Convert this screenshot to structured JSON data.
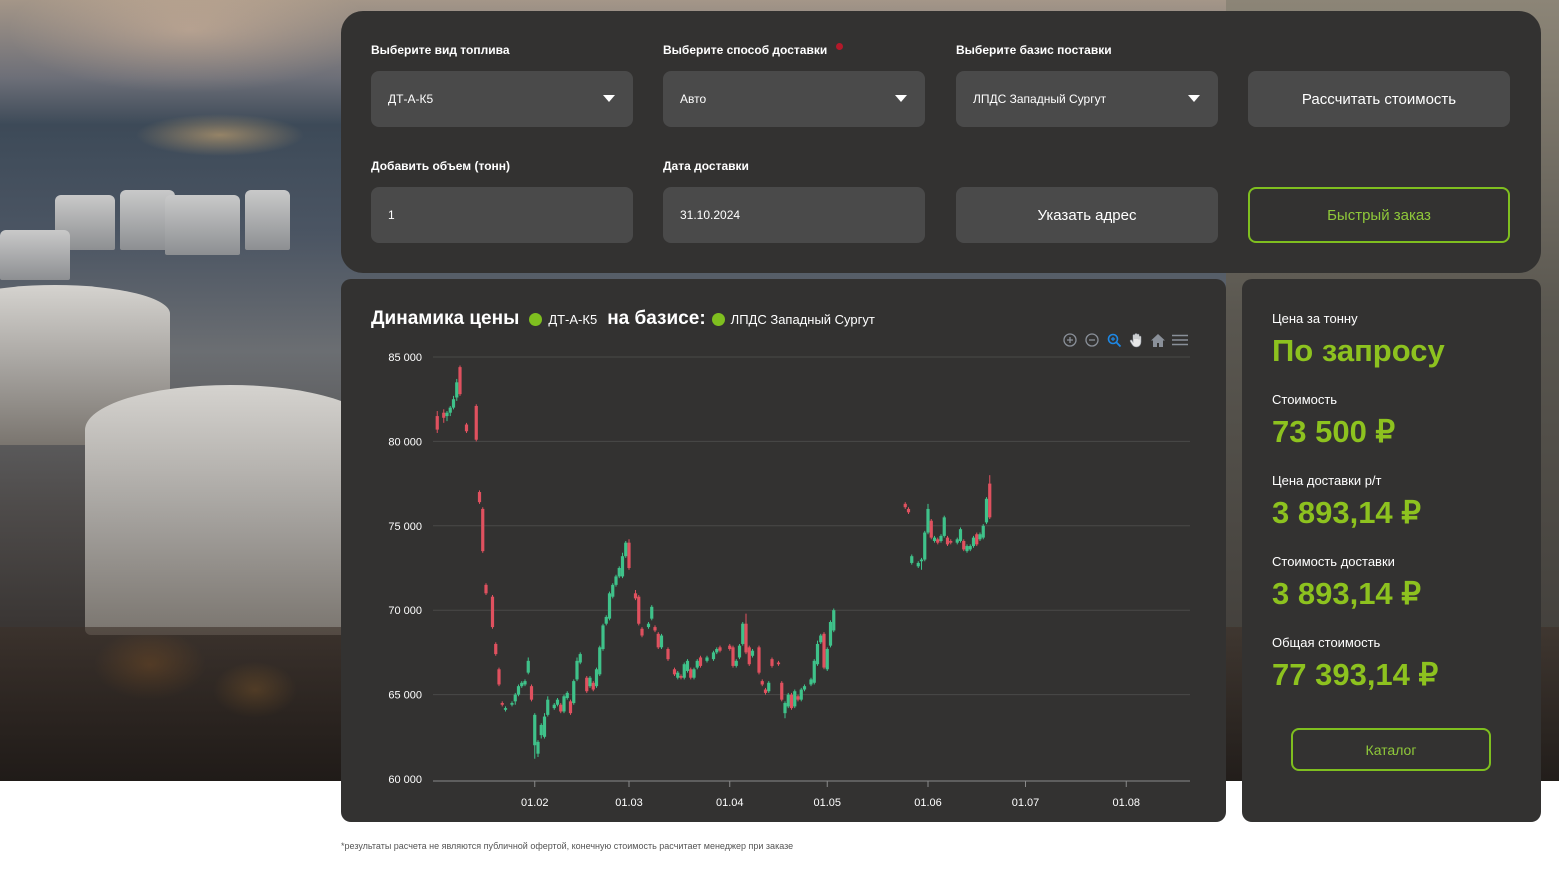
{
  "form": {
    "fuel_label": "Выберите вид топлива",
    "fuel_value": "ДТ-А-К5",
    "delivery_label": "Выберите способ доставки",
    "delivery_value": "Авто",
    "basis_label": "Выберите базис поставки",
    "basis_value": "ЛПДС Западный Сургут",
    "calc_button": "Рассчитать стоимость",
    "volume_label": "Добавить объем (тонн)",
    "volume_value": "1",
    "date_label": "Дата доставки",
    "date_value": "31.10.2024",
    "address_button": "Указать адрес",
    "quick_order_button": "Быстрый заказ"
  },
  "chart_header": {
    "title": "Динамика цены",
    "fuel": "ДТ-А-К5",
    "basis_prefix": "на базисе:",
    "basis": "ЛПДС Западный Сургут"
  },
  "colors": {
    "accent": "#8dc21f",
    "up": "#3fc28a",
    "down": "#e0515f",
    "panel": "#333231",
    "required": "#b3192a"
  },
  "toolbar_icons": [
    "zoom-in-icon",
    "zoom-out-icon",
    "zoom-select-icon",
    "pan-hand-icon",
    "home-reset-icon",
    "menu-icon"
  ],
  "chart_data": {
    "type": "candlestick",
    "title": "",
    "ylim": [
      60000,
      85000
    ],
    "yticks": [
      60000,
      65000,
      70000,
      75000,
      80000,
      85000
    ],
    "ytick_labels": [
      "60 000",
      "65 000",
      "70 000",
      "75 000",
      "80 000",
      "85 000"
    ],
    "xtick_labels": [
      "01.02",
      "01.03",
      "01.04",
      "01.05",
      "01.06",
      "01.07",
      "01.08"
    ],
    "xtick_days": [
      31,
      60,
      91,
      121,
      152,
      182,
      213
    ],
    "grid": true,
    "legend": "none",
    "series": [
      {
        "d": 1,
        "o": 81500,
        "c": 80700,
        "h": 81800,
        "l": 80500
      },
      {
        "d": 3,
        "o": 81700,
        "c": 81400,
        "h": 81900,
        "l": 81100
      },
      {
        "d": 4,
        "o": 81500,
        "c": 81700,
        "h": 81800,
        "l": 81200
      },
      {
        "d": 5,
        "o": 81700,
        "c": 82000,
        "h": 82100,
        "l": 81500
      },
      {
        "d": 6,
        "o": 82000,
        "c": 82500,
        "h": 82700,
        "l": 81900
      },
      {
        "d": 7,
        "o": 82600,
        "c": 83500,
        "h": 83700,
        "l": 82400
      },
      {
        "d": 8,
        "o": 84400,
        "c": 82800,
        "h": 84500,
        "l": 82700
      },
      {
        "d": 10,
        "o": 81000,
        "c": 80600,
        "h": 81100,
        "l": 80500
      },
      {
        "d": 13,
        "o": 82100,
        "c": 80100,
        "h": 82200,
        "l": 80000
      },
      {
        "d": 14,
        "o": 77000,
        "c": 76400,
        "h": 77100,
        "l": 76300
      },
      {
        "d": 15,
        "o": 76000,
        "c": 73500,
        "h": 76100,
        "l": 73400
      },
      {
        "d": 16,
        "o": 71500,
        "c": 71000,
        "h": 71600,
        "l": 70900
      },
      {
        "d": 18,
        "o": 70800,
        "c": 69000,
        "h": 70900,
        "l": 68900
      },
      {
        "d": 19,
        "o": 68000,
        "c": 67400,
        "h": 68100,
        "l": 67300
      },
      {
        "d": 20,
        "o": 66500,
        "c": 65600,
        "h": 66600,
        "l": 65500
      },
      {
        "d": 21,
        "o": 64500,
        "c": 64400,
        "h": 64600,
        "l": 64300
      },
      {
        "d": 22,
        "o": 64100,
        "c": 64200,
        "h": 64300,
        "l": 64000
      },
      {
        "d": 24,
        "o": 64400,
        "c": 64500,
        "h": 64600,
        "l": 64300
      },
      {
        "d": 25,
        "o": 64600,
        "c": 65000,
        "h": 65100,
        "l": 64400
      },
      {
        "d": 26,
        "o": 65000,
        "c": 65500,
        "h": 65600,
        "l": 64900
      },
      {
        "d": 27,
        "o": 65500,
        "c": 65700,
        "h": 65800,
        "l": 65400
      },
      {
        "d": 28,
        "o": 65600,
        "c": 65800,
        "h": 65900,
        "l": 65500
      },
      {
        "d": 29,
        "o": 66300,
        "c": 67000,
        "h": 67200,
        "l": 66200
      },
      {
        "d": 30,
        "o": 65500,
        "c": 64700,
        "h": 65600,
        "l": 64600
      },
      {
        "d": 31,
        "o": 62000,
        "c": 63800,
        "h": 63900,
        "l": 61200
      },
      {
        "d": 32,
        "o": 61500,
        "c": 62200,
        "h": 62300,
        "l": 61300
      },
      {
        "d": 33,
        "o": 62600,
        "c": 63200,
        "h": 63300,
        "l": 62400
      },
      {
        "d": 34,
        "o": 62500,
        "c": 63700,
        "h": 63900,
        "l": 62400
      },
      {
        "d": 35,
        "o": 63800,
        "c": 64700,
        "h": 64900,
        "l": 63700
      },
      {
        "d": 37,
        "o": 64200,
        "c": 64400,
        "h": 64500,
        "l": 64100
      },
      {
        "d": 38,
        "o": 64400,
        "c": 64700,
        "h": 64800,
        "l": 64300
      },
      {
        "d": 39,
        "o": 64400,
        "c": 64000,
        "h": 64500,
        "l": 63900
      },
      {
        "d": 40,
        "o": 64000,
        "c": 64900,
        "h": 65000,
        "l": 63900
      },
      {
        "d": 41,
        "o": 64800,
        "c": 65100,
        "h": 65200,
        "l": 64700
      },
      {
        "d": 42,
        "o": 64600,
        "c": 63900,
        "h": 64700,
        "l": 63800
      },
      {
        "d": 43,
        "o": 64500,
        "c": 65800,
        "h": 65900,
        "l": 64400
      },
      {
        "d": 44,
        "o": 65900,
        "c": 67000,
        "h": 67200,
        "l": 65800
      },
      {
        "d": 45,
        "o": 66900,
        "c": 67400,
        "h": 67500,
        "l": 66800
      },
      {
        "d": 47,
        "o": 66000,
        "c": 65200,
        "h": 66100,
        "l": 65100
      },
      {
        "d": 48,
        "o": 65500,
        "c": 66000,
        "h": 66100,
        "l": 65400
      },
      {
        "d": 49,
        "o": 65700,
        "c": 65300,
        "h": 65800,
        "l": 65200
      },
      {
        "d": 50,
        "o": 65500,
        "c": 66500,
        "h": 66600,
        "l": 65400
      },
      {
        "d": 51,
        "o": 66200,
        "c": 67800,
        "h": 67900,
        "l": 66100
      },
      {
        "d": 52,
        "o": 67700,
        "c": 69100,
        "h": 69200,
        "l": 67600
      },
      {
        "d": 53,
        "o": 69200,
        "c": 69600,
        "h": 69700,
        "l": 69100
      },
      {
        "d": 54,
        "o": 69500,
        "c": 71000,
        "h": 71100,
        "l": 69400
      },
      {
        "d": 55,
        "o": 70800,
        "c": 71500,
        "h": 71600,
        "l": 70700
      },
      {
        "d": 56,
        "o": 71500,
        "c": 72000,
        "h": 72100,
        "l": 71400
      },
      {
        "d": 57,
        "o": 72000,
        "c": 72500,
        "h": 72600,
        "l": 71900
      },
      {
        "d": 58,
        "o": 72000,
        "c": 73200,
        "h": 73400,
        "l": 71900
      },
      {
        "d": 59,
        "o": 73200,
        "c": 74000,
        "h": 74100,
        "l": 73100
      },
      {
        "d": 60,
        "o": 74000,
        "c": 72500,
        "h": 74200,
        "l": 72400
      },
      {
        "d": 62,
        "o": 71000,
        "c": 70700,
        "h": 71200,
        "l": 70600
      },
      {
        "d": 63,
        "o": 70800,
        "c": 69200,
        "h": 70900,
        "l": 69100
      },
      {
        "d": 64,
        "o": 68900,
        "c": 68500,
        "h": 69000,
        "l": 68400
      },
      {
        "d": 66,
        "o": 69000,
        "c": 69200,
        "h": 69300,
        "l": 68900
      },
      {
        "d": 67,
        "o": 69500,
        "c": 70200,
        "h": 70300,
        "l": 69400
      },
      {
        "d": 68,
        "o": 69000,
        "c": 68800,
        "h": 69100,
        "l": 68700
      },
      {
        "d": 69,
        "o": 68600,
        "c": 67800,
        "h": 68700,
        "l": 67700
      },
      {
        "d": 70,
        "o": 67800,
        "c": 68500,
        "h": 68600,
        "l": 67700
      },
      {
        "d": 72,
        "o": 67700,
        "c": 67100,
        "h": 67800,
        "l": 67000
      },
      {
        "d": 74,
        "o": 66500,
        "c": 66200,
        "h": 66600,
        "l": 66100
      },
      {
        "d": 75,
        "o": 66000,
        "c": 66300,
        "h": 66400,
        "l": 65900
      },
      {
        "d": 76,
        "o": 66100,
        "c": 66000,
        "h": 66200,
        "l": 65900
      },
      {
        "d": 77,
        "o": 66000,
        "c": 66800,
        "h": 66900,
        "l": 65900
      },
      {
        "d": 78,
        "o": 66400,
        "c": 67000,
        "h": 67100,
        "l": 66300
      },
      {
        "d": 79,
        "o": 66500,
        "c": 66000,
        "h": 66600,
        "l": 65900
      },
      {
        "d": 80,
        "o": 66000,
        "c": 66500,
        "h": 66600,
        "l": 65900
      },
      {
        "d": 81,
        "o": 66600,
        "c": 67000,
        "h": 67100,
        "l": 66500
      },
      {
        "d": 82,
        "o": 67200,
        "c": 66700,
        "h": 67300,
        "l": 66600
      },
      {
        "d": 84,
        "o": 67000,
        "c": 67200,
        "h": 67300,
        "l": 66900
      },
      {
        "d": 86,
        "o": 67100,
        "c": 67500,
        "h": 67600,
        "l": 67000
      },
      {
        "d": 87,
        "o": 67500,
        "c": 67700,
        "h": 67800,
        "l": 67400
      },
      {
        "d": 88,
        "o": 67800,
        "c": 67600,
        "h": 67900,
        "l": 67500
      },
      {
        "d": 91,
        "o": 67900,
        "c": 67700,
        "h": 68000,
        "l": 67600
      },
      {
        "d": 92,
        "o": 67800,
        "c": 66700,
        "h": 67900,
        "l": 66600
      },
      {
        "d": 93,
        "o": 66700,
        "c": 67000,
        "h": 67100,
        "l": 66600
      },
      {
        "d": 94,
        "o": 67200,
        "c": 67900,
        "h": 68000,
        "l": 67100
      },
      {
        "d": 95,
        "o": 68000,
        "c": 69200,
        "h": 69300,
        "l": 67900
      },
      {
        "d": 96,
        "o": 69200,
        "c": 67500,
        "h": 69800,
        "l": 67400
      },
      {
        "d": 97,
        "o": 67800,
        "c": 66800,
        "h": 67900,
        "l": 66700
      },
      {
        "d": 98,
        "o": 67300,
        "c": 67600,
        "h": 67700,
        "l": 67200
      },
      {
        "d": 100,
        "o": 67800,
        "c": 66300,
        "h": 67900,
        "l": 66200
      },
      {
        "d": 101,
        "o": 65800,
        "c": 65600,
        "h": 65900,
        "l": 65500
      },
      {
        "d": 102,
        "o": 65300,
        "c": 65100,
        "h": 65400,
        "l": 65000
      },
      {
        "d": 103,
        "o": 65200,
        "c": 65700,
        "h": 65800,
        "l": 65100
      },
      {
        "d": 104,
        "o": 67100,
        "c": 66700,
        "h": 67200,
        "l": 66600
      },
      {
        "d": 106,
        "o": 66900,
        "c": 66800,
        "h": 67000,
        "l": 66700
      },
      {
        "d": 107,
        "o": 65700,
        "c": 64700,
        "h": 65800,
        "l": 64600
      },
      {
        "d": 108,
        "o": 63900,
        "c": 64500,
        "h": 64600,
        "l": 63600
      },
      {
        "d": 109,
        "o": 64300,
        "c": 65000,
        "h": 65100,
        "l": 64200
      },
      {
        "d": 110,
        "o": 65000,
        "c": 64200,
        "h": 65100,
        "l": 64100
      },
      {
        "d": 111,
        "o": 64300,
        "c": 65200,
        "h": 65300,
        "l": 64200
      },
      {
        "d": 112,
        "o": 64900,
        "c": 64700,
        "h": 65000,
        "l": 64600
      },
      {
        "d": 113,
        "o": 64700,
        "c": 65300,
        "h": 65400,
        "l": 64600
      },
      {
        "d": 114,
        "o": 65300,
        "c": 65500,
        "h": 65600,
        "l": 65200
      },
      {
        "d": 116,
        "o": 65600,
        "c": 65900,
        "h": 66000,
        "l": 65500
      },
      {
        "d": 117,
        "o": 65700,
        "c": 67000,
        "h": 67100,
        "l": 65600
      },
      {
        "d": 118,
        "o": 66800,
        "c": 68000,
        "h": 68200,
        "l": 66700
      },
      {
        "d": 119,
        "o": 68100,
        "c": 68500,
        "h": 68600,
        "l": 68000
      },
      {
        "d": 120,
        "o": 68600,
        "c": 66600,
        "h": 68700,
        "l": 66500
      },
      {
        "d": 121,
        "o": 66500,
        "c": 67700,
        "h": 67800,
        "l": 66400
      },
      {
        "d": 122,
        "o": 67900,
        "c": 69300,
        "h": 69400,
        "l": 67800
      },
      {
        "d": 123,
        "o": 68800,
        "c": 70000,
        "h": 70100,
        "l": 68700
      },
      {
        "d": 145,
        "o": 76300,
        "c": 76100,
        "h": 76400,
        "l": 76000
      },
      {
        "d": 146,
        "o": 76000,
        "c": 75800,
        "h": 76100,
        "l": 75700
      },
      {
        "d": 147,
        "o": 72800,
        "c": 73200,
        "h": 73300,
        "l": 72700
      },
      {
        "d": 149,
        "o": 72600,
        "c": 72800,
        "h": 72900,
        "l": 72500
      },
      {
        "d": 150,
        "o": 72900,
        "c": 73000,
        "h": 73100,
        "l": 72400
      },
      {
        "d": 151,
        "o": 73000,
        "c": 74600,
        "h": 74700,
        "l": 72900
      },
      {
        "d": 152,
        "o": 74600,
        "c": 76000,
        "h": 76300,
        "l": 74500
      },
      {
        "d": 153,
        "o": 75300,
        "c": 74300,
        "h": 75400,
        "l": 74200
      },
      {
        "d": 154,
        "o": 74100,
        "c": 74300,
        "h": 74400,
        "l": 74000
      },
      {
        "d": 155,
        "o": 74200,
        "c": 74000,
        "h": 74300,
        "l": 73900
      },
      {
        "d": 156,
        "o": 74100,
        "c": 74400,
        "h": 74500,
        "l": 74000
      },
      {
        "d": 157,
        "o": 74400,
        "c": 75500,
        "h": 75600,
        "l": 74300
      },
      {
        "d": 158,
        "o": 74300,
        "c": 73900,
        "h": 74400,
        "l": 73800
      },
      {
        "d": 159,
        "o": 74100,
        "c": 74000,
        "h": 74200,
        "l": 73900
      },
      {
        "d": 161,
        "o": 74000,
        "c": 74200,
        "h": 74300,
        "l": 73900
      },
      {
        "d": 162,
        "o": 74100,
        "c": 74800,
        "h": 74900,
        "l": 74000
      },
      {
        "d": 163,
        "o": 74100,
        "c": 73600,
        "h": 74200,
        "l": 73500
      },
      {
        "d": 164,
        "o": 73500,
        "c": 73800,
        "h": 73900,
        "l": 73400
      },
      {
        "d": 165,
        "o": 73600,
        "c": 73800,
        "h": 73900,
        "l": 73500
      },
      {
        "d": 166,
        "o": 73800,
        "c": 74300,
        "h": 74400,
        "l": 73700
      },
      {
        "d": 167,
        "o": 74500,
        "c": 73900,
        "h": 74600,
        "l": 73800
      },
      {
        "d": 168,
        "o": 74200,
        "c": 74500,
        "h": 74600,
        "l": 74100
      },
      {
        "d": 169,
        "o": 74300,
        "c": 75000,
        "h": 75100,
        "l": 74200
      },
      {
        "d": 170,
        "o": 75200,
        "c": 76600,
        "h": 76700,
        "l": 75100
      },
      {
        "d": 171,
        "o": 77500,
        "c": 75500,
        "h": 78000,
        "l": 75400
      }
    ]
  },
  "summary": {
    "price_per_ton_label": "Цена за тонну",
    "price_per_ton_value": "По запросу",
    "cost_label": "Стоимость",
    "cost_value": "73 500 ₽",
    "delivery_rate_label": "Цена доставки р/т",
    "delivery_rate_value": "3 893,14 ₽",
    "delivery_cost_label": "Стоимость доставки",
    "delivery_cost_value": "3 893,14 ₽",
    "total_label": "Общая стоимость",
    "total_value": "77 393,14 ₽",
    "catalog_button": "Каталог"
  },
  "footnote": "*результаты расчета не являются публичной офертой, конечную стоимость расчитает менеджер при заказе"
}
